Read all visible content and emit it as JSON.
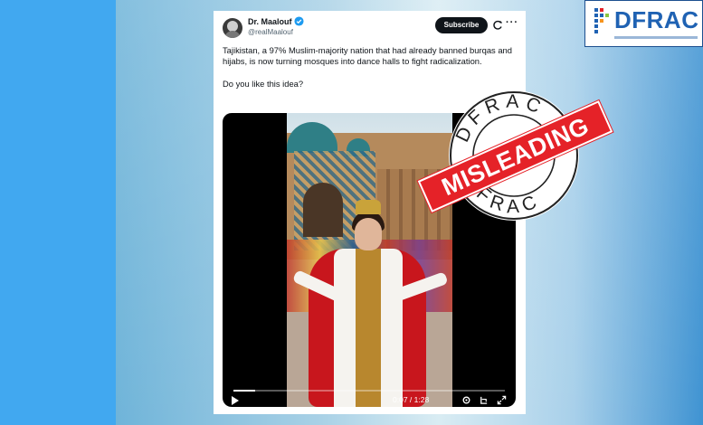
{
  "logo": {
    "text": "DFRAC"
  },
  "tweet": {
    "display_name": "Dr. Maalouf",
    "handle": "@realMaalouf",
    "subscribe_label": "Subscribe",
    "more_label": "···",
    "body_paragraph_1": "Tajikistan, a 97% Muslim-majority nation that had already banned burqas and hijabs, is now turning mosques into dance halls to fight radicalization.",
    "body_paragraph_2": "Do you like this idea?"
  },
  "video": {
    "time": "0:07 / 1:28",
    "progress": 0.08
  },
  "stamp": {
    "top_text": "DFRAC",
    "bottom_text": "DFRAC",
    "banner_label": "MISLEADING"
  },
  "colors": {
    "accent_red": "#e52228",
    "brand_blue": "#1f62b3",
    "verified_blue": "#1d9bf0"
  }
}
